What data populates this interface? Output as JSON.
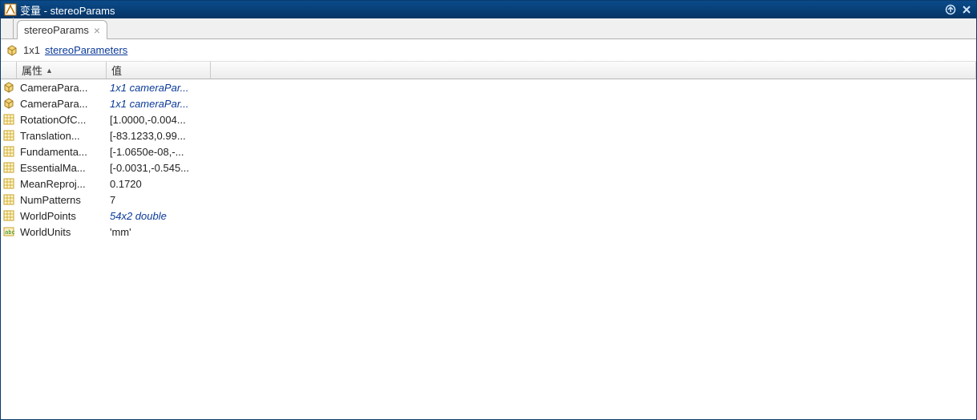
{
  "titlebar": {
    "prefix": "变量 - ",
    "var_name": "stereoParams"
  },
  "tab": {
    "label": "stereoParams"
  },
  "breadcrumb": {
    "size": "1x1",
    "type_link": "stereoParameters"
  },
  "grid": {
    "header_name": "属性",
    "header_value": "值"
  },
  "rows": [
    {
      "icon": "obj",
      "name": "CameraPara...",
      "value": "1x1 cameraPar...",
      "link": true
    },
    {
      "icon": "obj",
      "name": "CameraPara...",
      "value": "1x1 cameraPar...",
      "link": true
    },
    {
      "icon": "mat",
      "name": "RotationOfC...",
      "value": "[1.0000,-0.004...",
      "link": false
    },
    {
      "icon": "mat",
      "name": "Translation...",
      "value": "[-83.1233,0.99...",
      "link": false
    },
    {
      "icon": "mat",
      "name": "Fundamenta...",
      "value": "[-1.0650e-08,-...",
      "link": false
    },
    {
      "icon": "mat",
      "name": "EssentialMa...",
      "value": "[-0.0031,-0.545...",
      "link": false
    },
    {
      "icon": "mat",
      "name": "MeanReproj...",
      "value": "0.1720",
      "link": false
    },
    {
      "icon": "mat",
      "name": "NumPatterns",
      "value": "7",
      "link": false
    },
    {
      "icon": "mat",
      "name": "WorldPoints",
      "value": "54x2 double",
      "link": true
    },
    {
      "icon": "str",
      "name": "WorldUnits",
      "value": "'mm'",
      "link": false
    }
  ]
}
